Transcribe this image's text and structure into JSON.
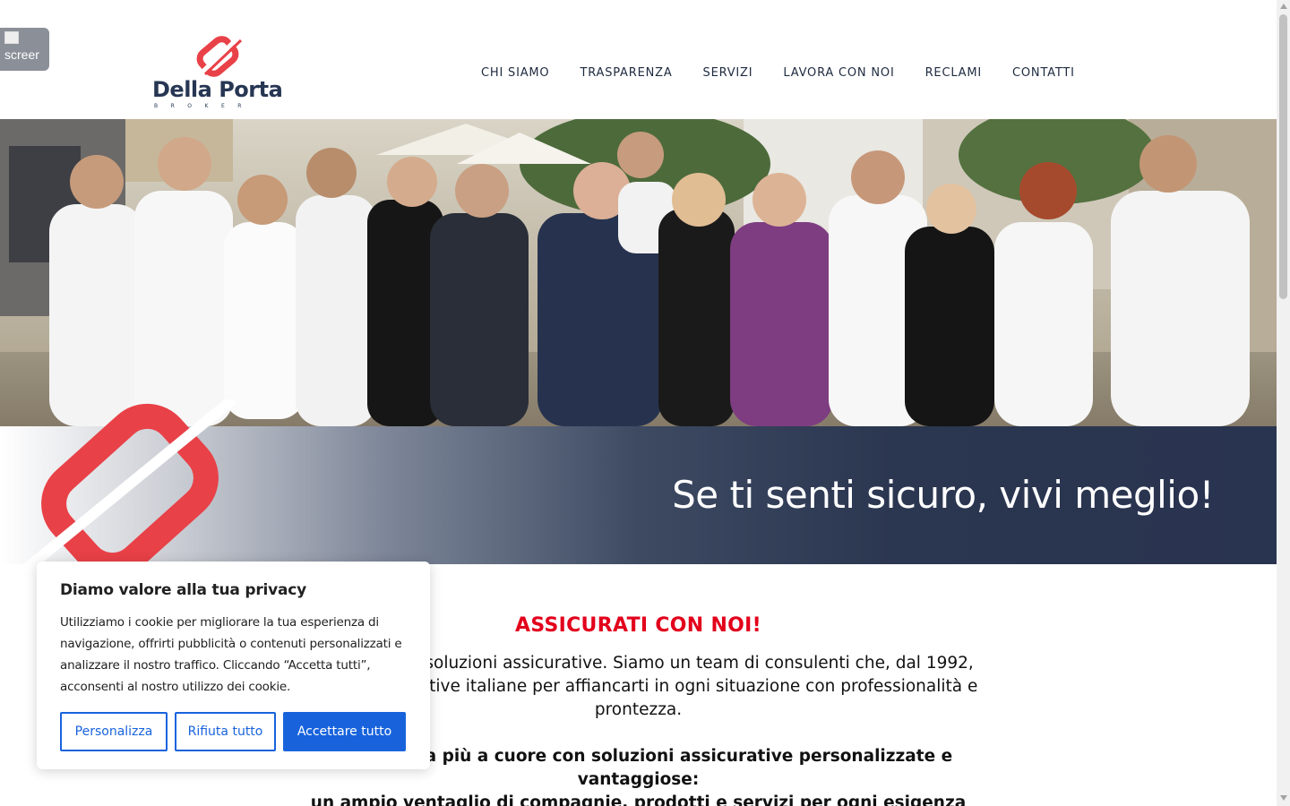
{
  "broken_image": {
    "alt": "screer"
  },
  "brand": {
    "name": "Della Porta",
    "tagline": "BROKER",
    "color_red": "#e84147",
    "color_navy": "#263653"
  },
  "nav": {
    "items": [
      {
        "label": "CHI SIAMO"
      },
      {
        "label": "TRASPARENZA"
      },
      {
        "label": "SERVIZI"
      },
      {
        "label": "LAVORA CON NOI"
      },
      {
        "label": "RECLAMI"
      },
      {
        "label": "CONTATTI"
      }
    ]
  },
  "hero": {
    "photo": "team-group-photo",
    "slogan": "Se ti senti sicuro, vivi meglio!"
  },
  "main": {
    "title": "ASSICURATI CON NOI!",
    "title_color": "#e3001b",
    "paragraph_lines": [
      "rirti le migliori soluzioni assicurative. Siamo un team di consulenti che, dal 1992,",
      "pagnie assicurative italiane per affiancarti in ogni situazione con professionalità e",
      "prontezza."
    ],
    "bold_lines": [
      "he più ti sta più a cuore con soluzioni assicurative personalizzate e",
      "vantaggiose:",
      "un ampio ventaglio di compagnie, prodotti e servizi per ogni esigenza"
    ]
  },
  "cookie_banner": {
    "title": "Diamo valore alla tua privacy",
    "text": "Utilizziamo i cookie per migliorare la tua esperienza di navigazione, offrirti pubblicità o contenuti personalizzati e analizzare il nostro traffico. Cliccando “Accetta tutti”, acconsenti al nostro utilizzo dei cookie.",
    "customize_label": "Personalizza",
    "reject_label": "Rifiuta tutto",
    "accept_label": "Accettare tutto",
    "button_color": "#1863dc"
  },
  "scrollbar": {
    "position_fraction": 0.0
  }
}
